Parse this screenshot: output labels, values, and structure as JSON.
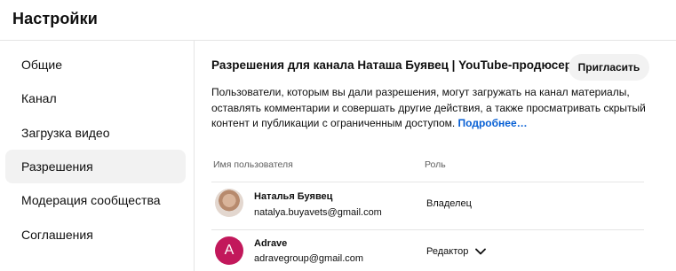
{
  "header": {
    "title": "Настройки"
  },
  "sidebar": {
    "items": [
      {
        "label": "Общие"
      },
      {
        "label": "Канал"
      },
      {
        "label": "Загрузка видео"
      },
      {
        "label": "Разрешения"
      },
      {
        "label": "Модерация сообщества"
      },
      {
        "label": "Соглашения"
      }
    ],
    "active_index": 3
  },
  "permissions": {
    "title": "Разрешения для канала Наташа Буявец | YouTube-продюсер",
    "invite_label": "Пригласить",
    "description": "Пользователи, которым вы дали разрешения, могут загружать на канал материалы, оставлять комментарии и совершать другие действия, а также просматривать скрытый контент и публикации с ограниченным доступом.",
    "more_link": "Подробнее…",
    "columns": {
      "user": "Имя пользователя",
      "role": "Роль"
    },
    "users": [
      {
        "name": "Наталья Буявец",
        "email": "natalya.buyavets@gmail.com",
        "role": "Владелец",
        "avatar": "photo"
      },
      {
        "name": "Adrave",
        "email": "adravegroup@gmail.com",
        "role": "Редактор",
        "avatar_letter": "A",
        "avatar_color": "#c2185b"
      }
    ]
  },
  "colors": {
    "accent_link": "#065fd4",
    "active_bg": "#f2f2f2",
    "avatar_a": "#c2185b"
  }
}
